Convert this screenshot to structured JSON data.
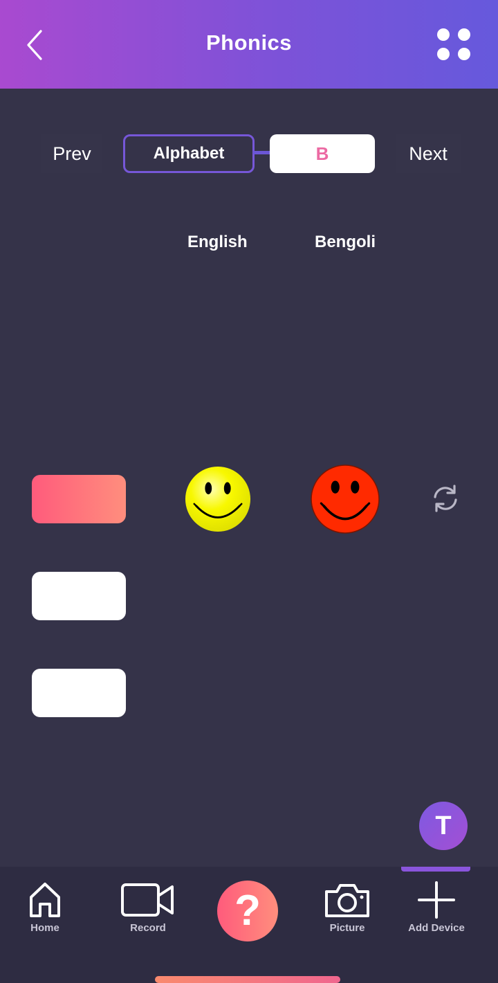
{
  "header": {
    "title": "Phonics",
    "back_icon": "chevron-left-icon",
    "menu_icon": "grid-dots-icon",
    "gradient": [
      "#a94ad0",
      "#6659dc"
    ]
  },
  "navigator": {
    "prev_label": "Prev",
    "category_label": "Alphabet",
    "current_letter": "B",
    "next_label": "Next"
  },
  "columns": {
    "english_label": "English",
    "bengoli_label": "Bengoli"
  },
  "choices": {
    "count": 3,
    "selected_index": 0,
    "selected_color": "#ff6f7d"
  },
  "results": {
    "english_icon": "yellow-smiley-icon",
    "english_color": "#f5f500",
    "bengoli_icon": "red-smiley-icon",
    "bengoli_color": "#ff2a00",
    "refresh_icon": "refresh-icon"
  },
  "user": {
    "avatar_letter": "T"
  },
  "bottom_nav": {
    "home": "Home",
    "record": "Record",
    "help_symbol": "?",
    "picture": "Picture",
    "add_device": "Add Device"
  }
}
